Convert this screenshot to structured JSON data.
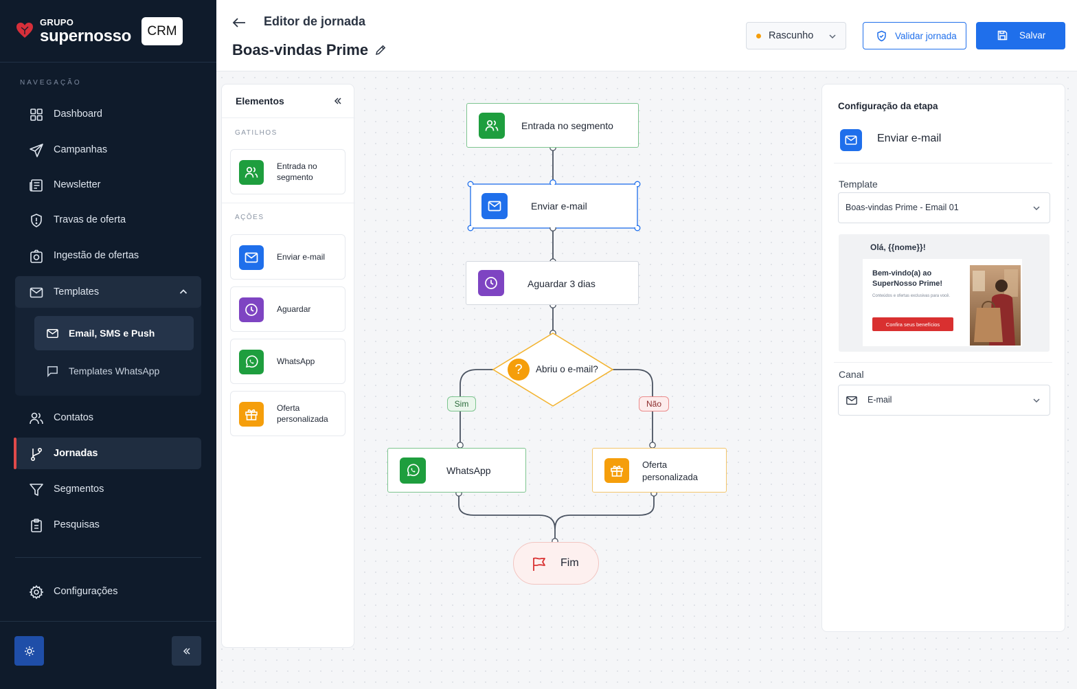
{
  "brand": {
    "group": "GRUPO",
    "name": "supernosso",
    "product": "CRM"
  },
  "nav": {
    "heading": "NAVEGAÇÃO",
    "items": [
      {
        "label": "Dashboard",
        "icon": "grid-icon"
      },
      {
        "label": "Campanhas",
        "icon": "send-icon"
      },
      {
        "label": "Newsletter",
        "icon": "newspaper-icon"
      },
      {
        "label": "Travas de oferta",
        "icon": "shield-icon"
      },
      {
        "label": "Ingestão de ofertas",
        "icon": "camera-icon"
      },
      {
        "label": "Templates",
        "icon": "mail-icon",
        "expanded": true
      },
      {
        "label": "Contatos",
        "icon": "users-icon"
      },
      {
        "label": "Jornadas",
        "icon": "git-branch-icon",
        "active": true
      },
      {
        "label": "Segmentos",
        "icon": "filter-icon"
      },
      {
        "label": "Pesquisas",
        "icon": "clipboard-icon"
      },
      {
        "label": "Configurações",
        "icon": "gear-icon"
      }
    ],
    "templates_children": [
      {
        "label": "Email, SMS e Push",
        "active": true
      },
      {
        "label": "Templates WhatsApp"
      }
    ]
  },
  "header": {
    "editor_title": "Editor de jornada",
    "journey_name": "Boas-vindas Prime",
    "status": "Rascunho",
    "status_color": "#f59e0b",
    "validate_label": "Validar jornada",
    "save_label": "Salvar",
    "accent": "#1f6feb"
  },
  "elements_panel": {
    "title": "Elementos",
    "triggers_heading": "GATILHOS",
    "triggers": [
      {
        "label": "Entrada no segmento",
        "color": "#1e9e3e"
      }
    ],
    "actions_heading": "AÇÕES",
    "actions": [
      {
        "label": "Enviar e-mail",
        "color": "#1f6feb"
      },
      {
        "label": "Aguardar",
        "color": "#7e44c2"
      },
      {
        "label": "WhatsApp",
        "color": "#1e9e3e"
      },
      {
        "label": "Oferta personalizada",
        "color": "#f59e0b"
      }
    ]
  },
  "flow": {
    "entry": "Entrada no segmento",
    "email": "Enviar e-mail",
    "wait": "Aguardar 3 dias",
    "decision": "Abriu o e-mail?",
    "yes": "Sim",
    "no": "Não",
    "whatsapp": "WhatsApp",
    "offer": "Oferta personalizada",
    "end": "Fim"
  },
  "config": {
    "title": "Configuração da etapa",
    "step_name": "Enviar e-mail",
    "template_label": "Template",
    "template_value": "Boas-vindas Prime - Email 01",
    "preview": {
      "greeting": "Olá, {{nome}}!",
      "headline": "Bem-vindo(a) ao SuperNosso Prime!",
      "subline": "Conteúdos e ofertas exclusivas para você.",
      "cta": "Confira seus benefícios"
    },
    "channel_label": "Canal",
    "channel_value": "E-mail"
  }
}
